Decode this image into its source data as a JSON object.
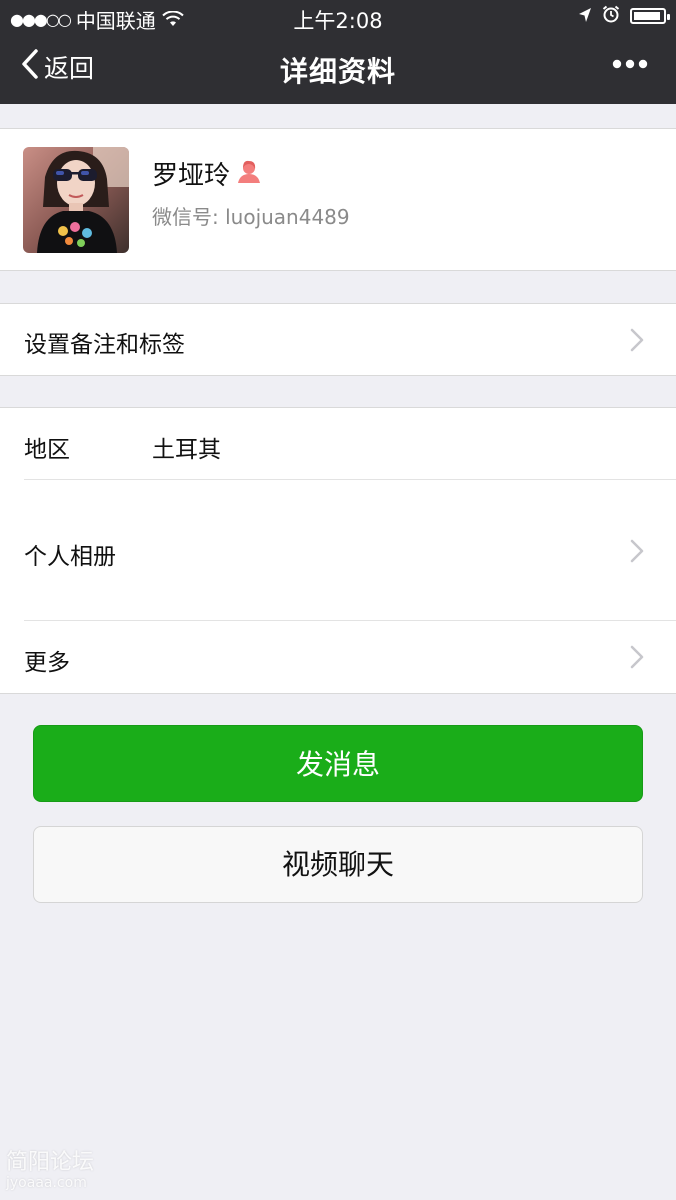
{
  "status_bar": {
    "signal": "●●●○○",
    "carrier": "中国联通",
    "time": "上午2:08"
  },
  "nav": {
    "back_label": "返回",
    "title": "详细资料",
    "more_icon": "more-dots-icon"
  },
  "profile": {
    "name": "罗垭玲",
    "wechat_id": "微信号: luojuan4489",
    "gender_icon": "female-icon",
    "gender_color": "#f37e7d"
  },
  "rows": {
    "remark": "设置备注和标签",
    "region_label": "地区",
    "region_value": "土耳其",
    "album": "个人相册",
    "more": "更多"
  },
  "buttons": {
    "send_message": "发消息",
    "video_chat": "视频聊天"
  },
  "watermark": {
    "text": "简阳论坛",
    "url": "jyoaaa.com"
  },
  "colors": {
    "nav_bg": "#2f2f33",
    "page_bg": "#efeff4",
    "primary_green": "#1aad19"
  }
}
